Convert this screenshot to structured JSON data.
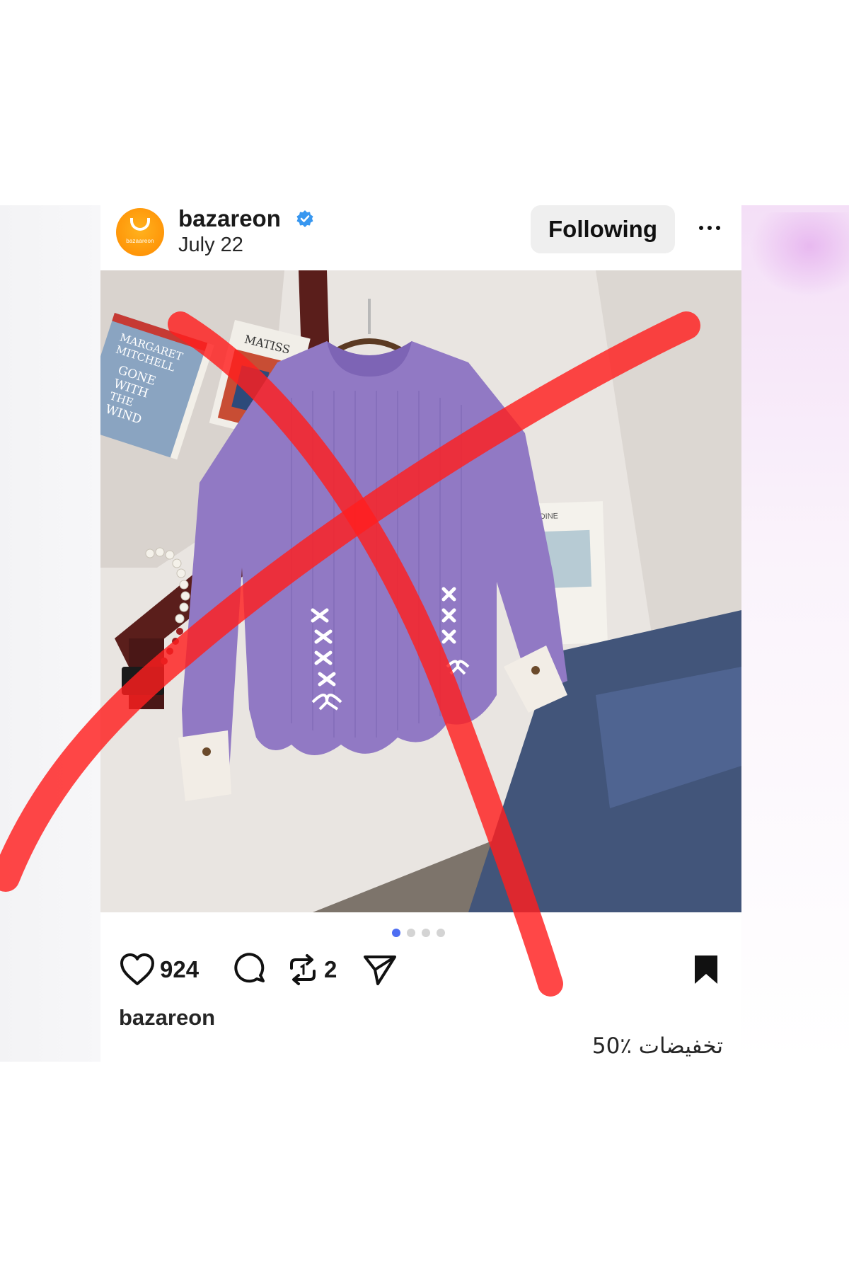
{
  "post": {
    "username": "bazareon",
    "verified": true,
    "date": "July 22",
    "follow_label": "Following",
    "avatar_text": "bazaareon",
    "more_label": "More options"
  },
  "carousel": {
    "total": 4,
    "active_index": 0
  },
  "photo": {
    "book1_lines": [
      "MARGARET",
      "MITCHELL",
      "GONE",
      "WITH",
      "THE",
      "WIND"
    ],
    "book2_title": "MATISS",
    "book3_text": "LDINE"
  },
  "actions": {
    "likes": "924",
    "reposts": "2"
  },
  "caption": {
    "username": "bazareon",
    "text": "تخفيضات ٪50"
  },
  "colors": {
    "verified_blue": "#3897f0",
    "strike_red": "#ff1e1e",
    "dot_active": "#4e6ef2",
    "sweater": "#9179c4"
  }
}
